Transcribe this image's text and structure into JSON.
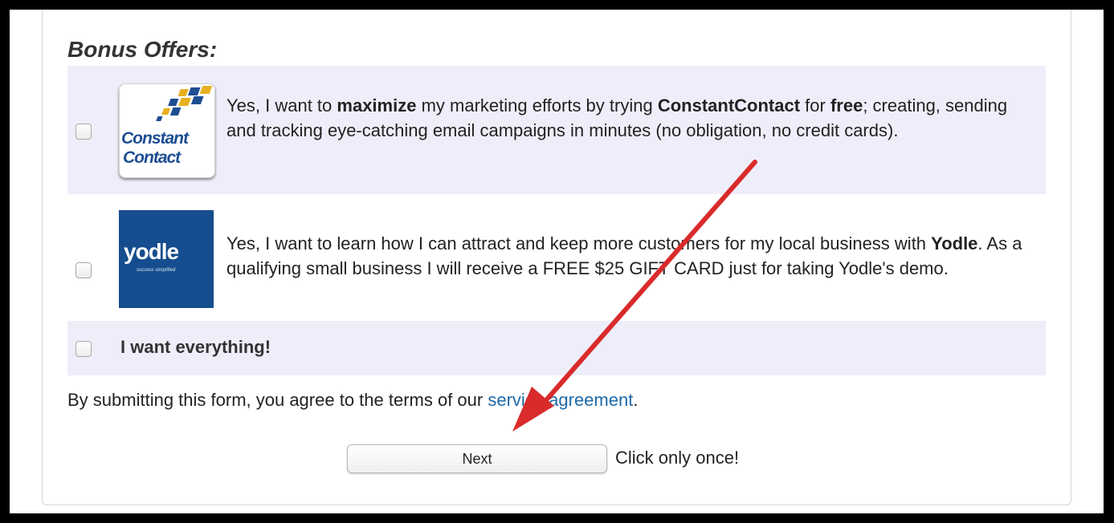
{
  "section_title": "Bonus Offers:",
  "offers": [
    {
      "logo_line1": "Constant",
      "logo_line2": "Contact",
      "text_parts": [
        "Yes, I want to ",
        "maximize",
        " my marketing efforts by trying ",
        "ConstantContact",
        " for ",
        "free",
        "; creating, sending and tracking eye-catching email campaigns in minutes (no obligation, no credit cards)."
      ],
      "checked": false
    },
    {
      "logo_word": "yodle",
      "logo_tagline": "success simplified",
      "text_parts": [
        "Yes, I want to learn how I can attract and keep more customers for my local business with ",
        "Yodle",
        ". As a qualifying small business I will receive a FREE $25 GIFT CARD just for taking Yodle's demo."
      ],
      "checked": false
    }
  ],
  "everything_label": "I want everything!",
  "terms_text": "By submitting this form, you agree to the terms of our ",
  "terms_link": "service agreement",
  "terms_end": ".",
  "next_button_label": "Next",
  "click_once_text": "Click only once!",
  "colors": {
    "row_shade": "#eeeefa",
    "link": "#1e6aa8",
    "arrow": "#d92b2b",
    "yodle_blue": "#154d8e"
  },
  "icons": {
    "constant_contact_logo": "constant-contact-logo",
    "yodle_logo": "yodle-logo",
    "annotation_arrow": "red-arrow-annotation"
  }
}
